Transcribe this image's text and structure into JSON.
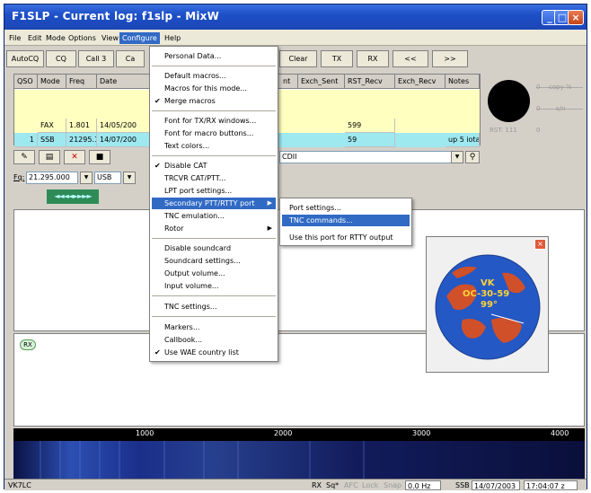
{
  "window": {
    "title": "F1SLP - Current log: f1slp - MixW",
    "minimize": "_",
    "maximize": "□",
    "close": "×"
  },
  "menubar": [
    "File",
    "Edit",
    "Mode",
    "Options",
    "View",
    "Configure",
    "Help"
  ],
  "toolbar": [
    "AutoCQ",
    "CQ",
    "Call 3",
    "Ca",
    "Clear",
    "TX",
    "RX",
    "<<",
    ">>"
  ],
  "log_table": {
    "columns": [
      "QSO",
      "Mode",
      "Freq",
      "Date",
      "nt",
      "Exch_Sent",
      "RST_Recv",
      "Exch_Recv",
      "Notes"
    ],
    "rows": [
      [
        "",
        "",
        "",
        "",
        "",
        "",
        "",
        "",
        ""
      ],
      [
        "",
        "",
        "",
        "",
        "",
        "",
        "",
        "",
        ""
      ],
      [
        "",
        "FAX",
        "1.801",
        "14/05/200",
        "",
        "",
        "599",
        "",
        ""
      ],
      [
        "1",
        "SSB",
        "21295.1",
        "14/07/200",
        "",
        "",
        "59",
        "",
        "up 5 iota"
      ]
    ]
  },
  "meter": {
    "labels": [
      "copy %",
      "s/n",
      "RST: 111"
    ],
    "scale_marks": [
      "0",
      "0",
      "0"
    ]
  },
  "controls": {
    "freq_label": "Fq:",
    "freq_value": "21.295.000",
    "mode_value": "USB",
    "dx_field": "CDII",
    "green_bar": "◄◄◄◄►►►►"
  },
  "configure_menu": {
    "items": [
      {
        "label": "Personal Data...",
        "check": ""
      },
      {
        "label": "Default macros...",
        "check": ""
      },
      {
        "label": "Macros for this mode...",
        "check": ""
      },
      {
        "label": "Merge macros",
        "check": "✔"
      },
      {
        "label": "Font for TX/RX windows...",
        "check": ""
      },
      {
        "label": "Font for macro buttons...",
        "check": ""
      },
      {
        "label": "Text colors...",
        "check": ""
      },
      {
        "label": "Disable CAT",
        "check": "✔"
      },
      {
        "label": "TRCVR CAT/PTT...",
        "check": ""
      },
      {
        "label": "LPT port settings...",
        "check": ""
      },
      {
        "label": "Secondary PTT/RTTY port",
        "check": "",
        "arrow": "▶"
      },
      {
        "label": "TNC emulation...",
        "check": ""
      },
      {
        "label": "Rotor",
        "check": "",
        "arrow": "▶"
      },
      {
        "label": "Disable soundcard",
        "check": ""
      },
      {
        "label": "Soundcard settings...",
        "check": ""
      },
      {
        "label": "Output volume...",
        "check": ""
      },
      {
        "label": "Input volume...",
        "check": ""
      },
      {
        "label": "TNC settings...",
        "check": ""
      },
      {
        "label": "Markers...",
        "check": ""
      },
      {
        "label": "Callbook...",
        "check": ""
      },
      {
        "label": "Use WAE country list",
        "check": "✔"
      }
    ]
  },
  "submenu": {
    "items": [
      "Port settings...",
      "TNC commands...",
      "Use this port for RTTY output"
    ]
  },
  "globe": {
    "line1": "VK",
    "line2": "OC-30-59",
    "line3": "99°",
    "close": "×"
  },
  "rx_tag": "RX",
  "waterfall_scale": [
    "1000",
    "2000",
    "3000",
    "4000"
  ],
  "statusbar": {
    "call": "VK7LC",
    "rx": "RX",
    "sq": "Sq*",
    "afc": "AFC",
    "lock": "Lock",
    "snap": "Snap",
    "offset": "0.0 Hz",
    "mode": "SSB",
    "date": "14/07/2003",
    "time": "17:04:07 z"
  },
  "colors": {
    "title_blue": "#1d4fc7",
    "menu_highlight": "#316ac5",
    "row_yellow": "#ffffc0",
    "row_cyan": "#9ee8f0",
    "globe_ocean": "#2458c4",
    "globe_land": "#d0502a"
  }
}
